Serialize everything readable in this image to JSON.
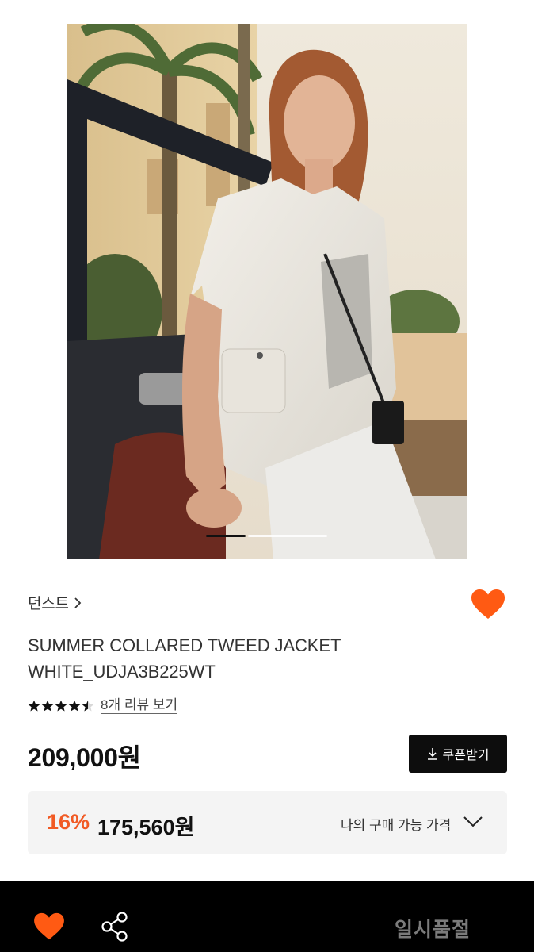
{
  "product": {
    "brand": "던스트",
    "title_line1": "SUMMER COLLARED TWEED JACKET",
    "title_line2": "WHITE_UDJA3B225WT",
    "rating": 4.5,
    "review_link": "8개 리뷰 보기",
    "price": "209,000원",
    "coupon_label": "쿠폰받기",
    "discount_rate": "16%",
    "discount_price": "175,560원",
    "my_price_label": "나의 구매 가능 가격",
    "wishlisted": true
  },
  "image": {
    "total_slides": 2,
    "current_slide": 1
  },
  "bottom_bar": {
    "soldout_label": "일시품절"
  },
  "colors": {
    "accent": "#f15a24",
    "heart": "#ff5a13",
    "bar_bg": "#000000",
    "soldout_text": "#7b7b7b"
  },
  "icons": [
    "chevron-right-icon",
    "heart-icon",
    "star-icon",
    "half-star-icon",
    "download-icon",
    "chevron-down-icon",
    "share-icon"
  ]
}
